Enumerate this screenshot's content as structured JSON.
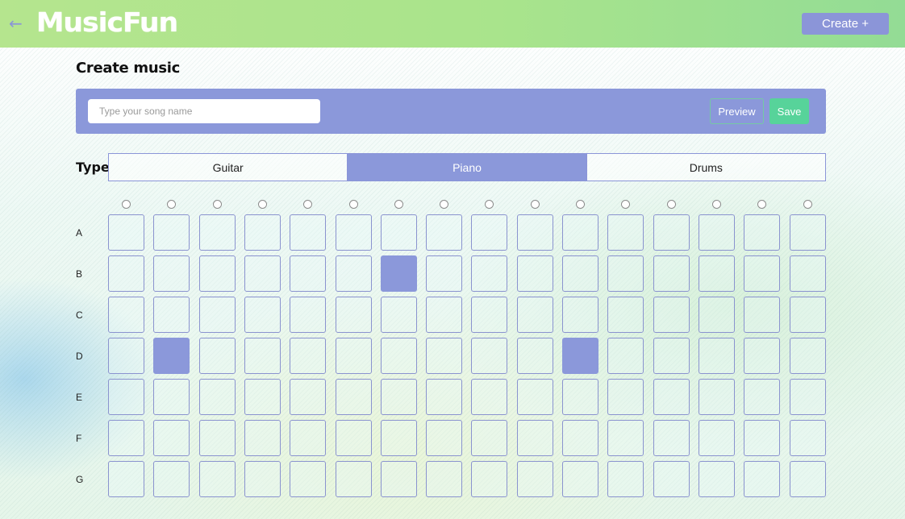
{
  "header": {
    "back_icon": "arrow-left-icon",
    "logo": "MusicFun",
    "create_label": "Create +"
  },
  "page": {
    "title": "Create music"
  },
  "toolbar": {
    "song_name_placeholder": "Type your song name",
    "song_name_value": "",
    "preview_label": "Preview",
    "save_label": "Save"
  },
  "type_selector": {
    "label": "Type",
    "options": [
      "Guitar",
      "Piano",
      "Drums"
    ],
    "selected": "Piano"
  },
  "grid": {
    "columns": 16,
    "rows": [
      "A",
      "B",
      "C",
      "D",
      "E",
      "F",
      "G"
    ],
    "active_cells": [
      {
        "row": "B",
        "col": 7
      },
      {
        "row": "D",
        "col": 2
      },
      {
        "row": "D",
        "col": 11
      }
    ]
  },
  "colors": {
    "header_green": "#a9e48c",
    "accent_purple": "#8b98da",
    "save_green": "#57d39a"
  }
}
